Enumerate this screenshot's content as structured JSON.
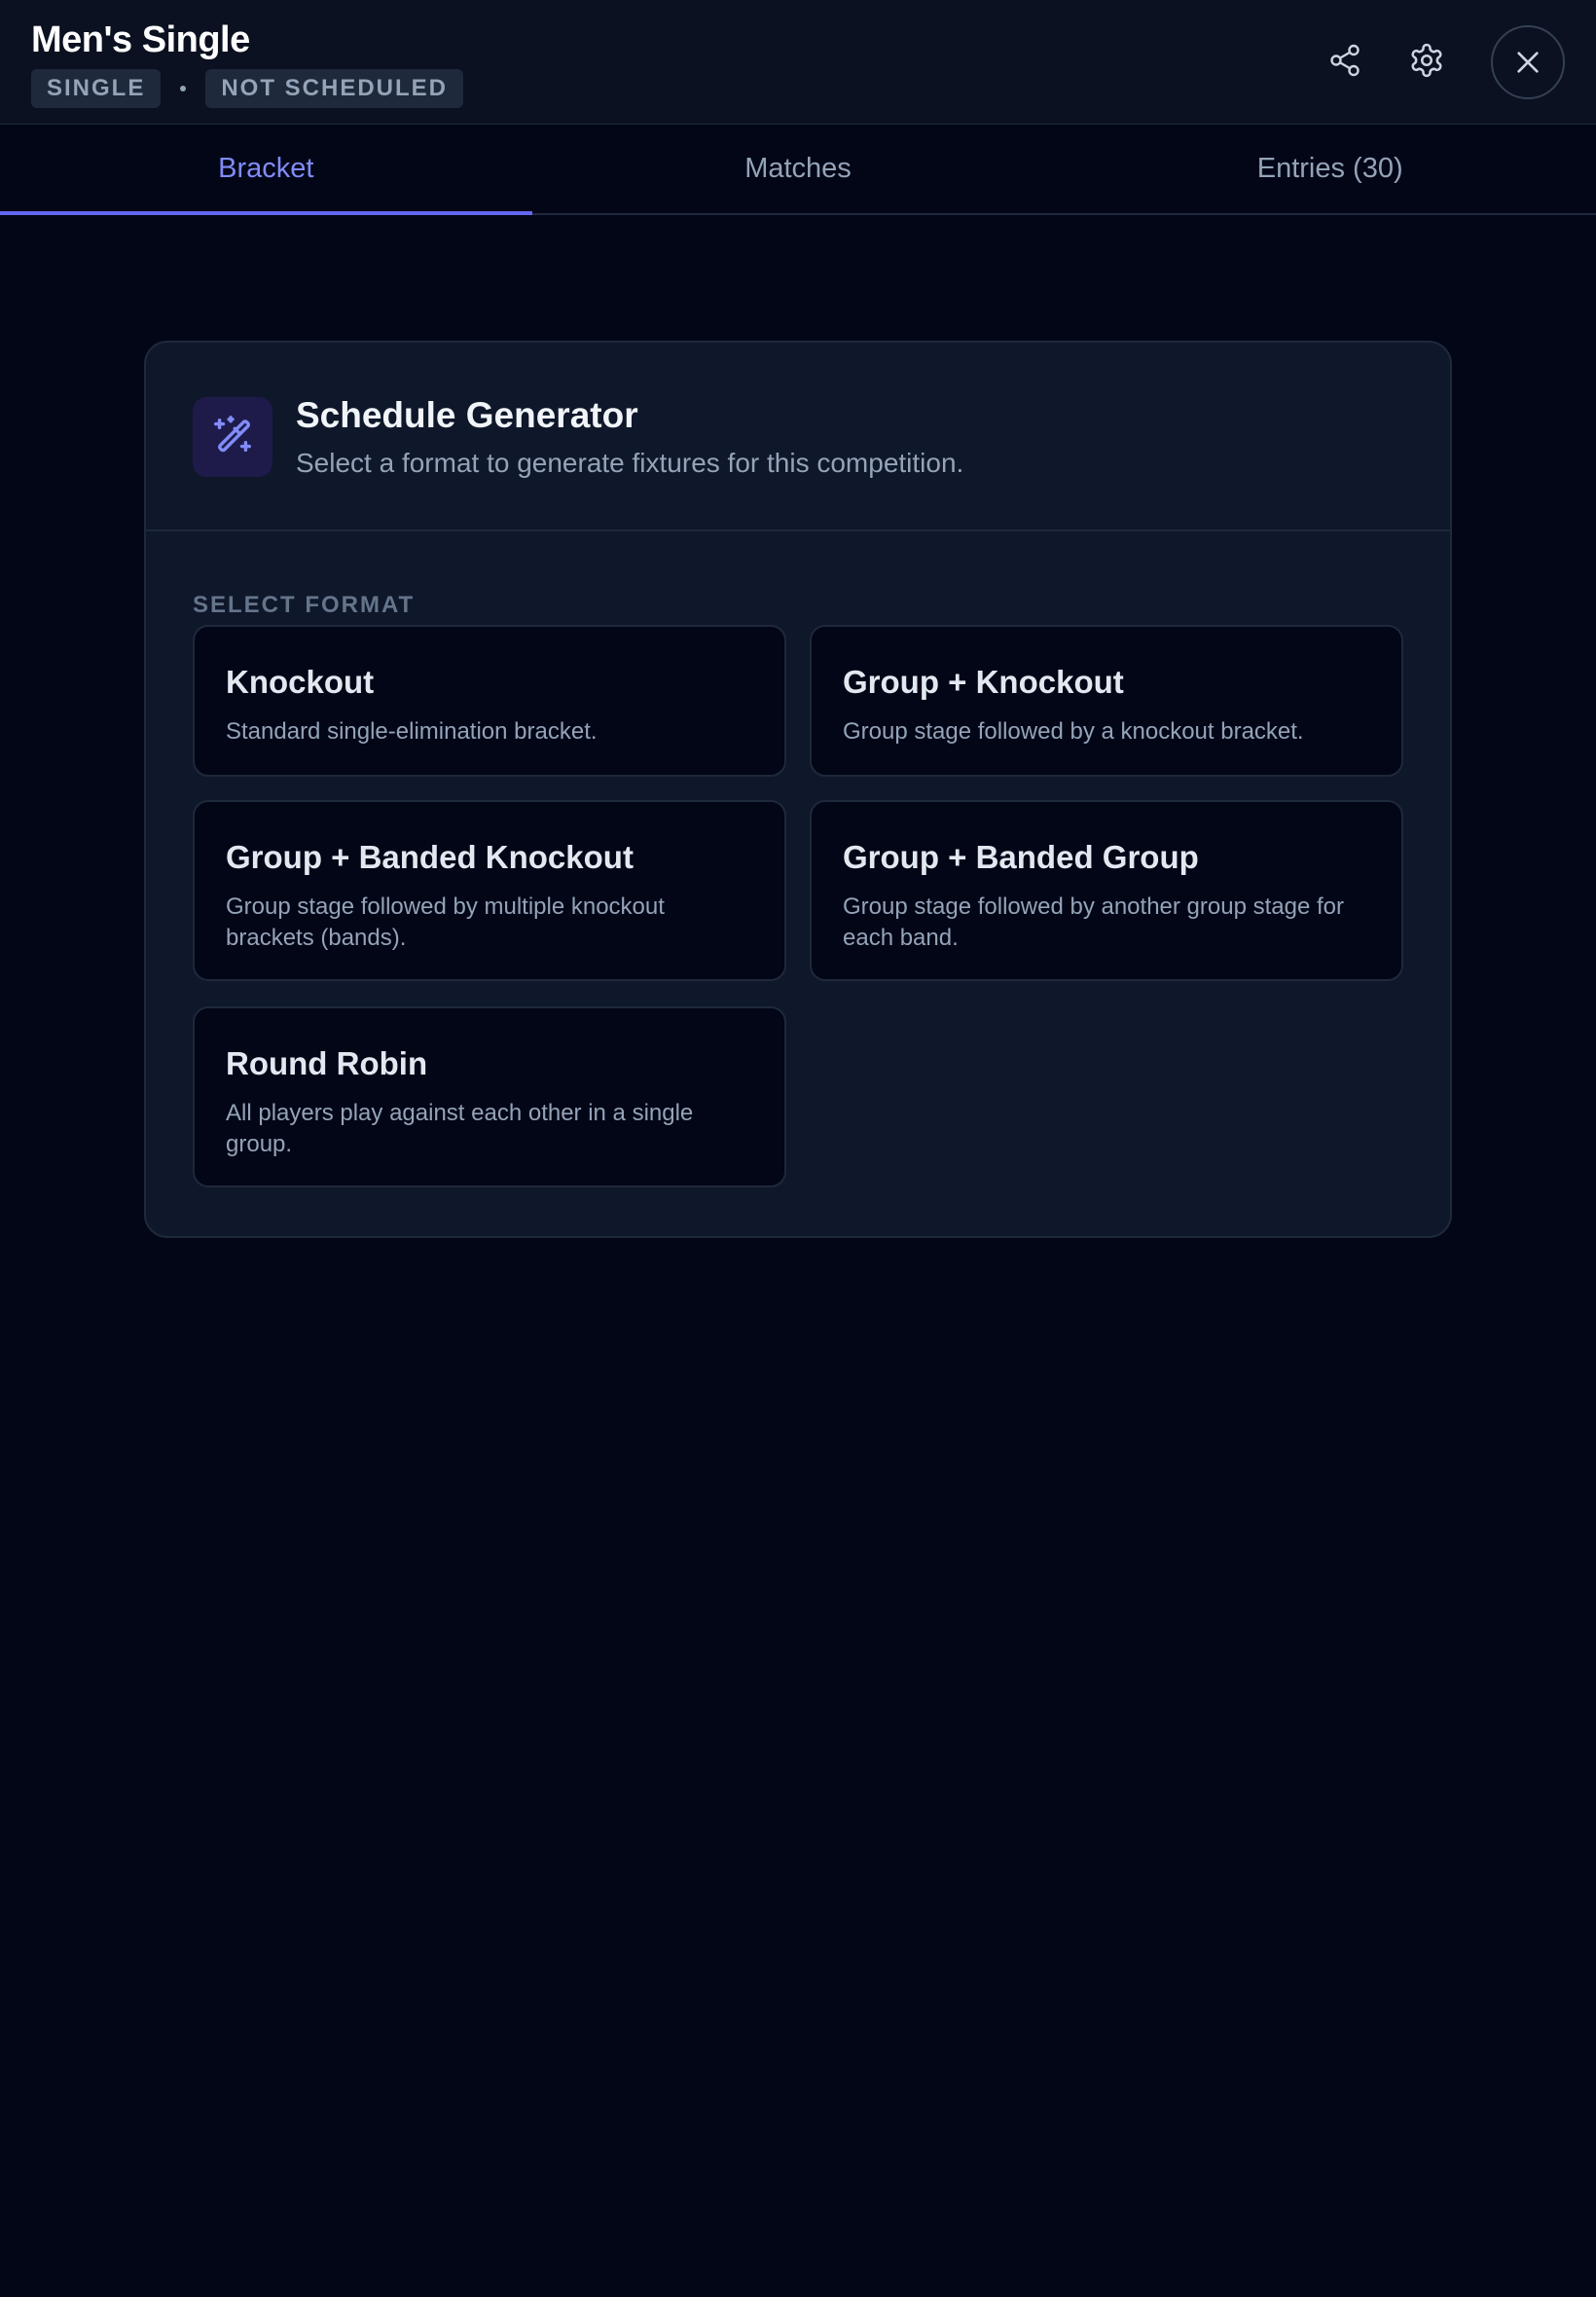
{
  "header": {
    "title": "Men's Single",
    "badges": [
      "SINGLE",
      "NOT SCHEDULED"
    ]
  },
  "tabs": [
    {
      "label": "Bracket",
      "active": true
    },
    {
      "label": "Matches",
      "active": false
    },
    {
      "label": "Entries (30)",
      "active": false
    }
  ],
  "generator": {
    "title": "Schedule Generator",
    "subtitle": "Select a format to generate fixtures for this competition.",
    "section_label": "SELECT FORMAT",
    "formats": [
      {
        "title": "Knockout",
        "description": "Standard single-elimination bracket."
      },
      {
        "title": "Group + Knockout",
        "description": "Group stage followed by a knockout bracket."
      },
      {
        "title": "Group + Banded Knockout",
        "description": "Group stage followed by multiple knockout brackets (bands)."
      },
      {
        "title": "Group + Banded Group",
        "description": "Group stage followed by another group stage for each band."
      },
      {
        "title": "Round Robin",
        "description": "All players play against each other in a single group."
      }
    ]
  },
  "icons": {
    "share": "share-icon",
    "settings": "gear-icon",
    "close": "close-icon",
    "generator": "magic-wand-icon"
  },
  "colors": {
    "background": "#020617",
    "accent": "#6366f1",
    "accent_text": "#818cf8"
  }
}
